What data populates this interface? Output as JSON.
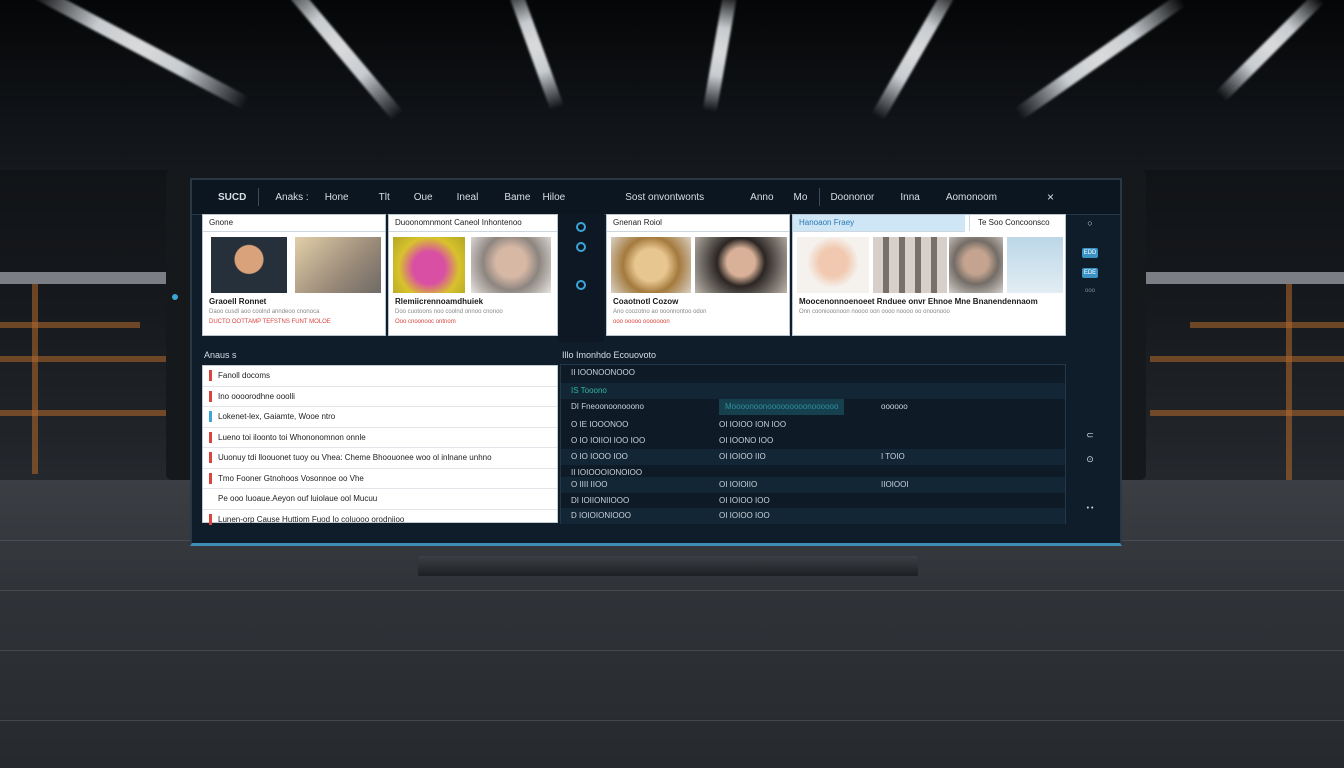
{
  "topbar": {
    "items": [
      "SUCD",
      "Anaks :",
      "Hone",
      "Tlt",
      "Oue",
      "Ineal",
      "Bame",
      "Hiloe",
      "Sost onvontwonts",
      "Anno",
      "Mo",
      "Doononor",
      "Inna",
      "Aomonoom"
    ],
    "close": "×"
  },
  "cards": [
    {
      "title": "Gnone",
      "caption": "Graoell Ronnet",
      "line1": "Daoo cusdl aoo coolnd anndeoo cnonoca",
      "line2": "DUCTO OOTTAMP TEFSTNS FUNT MOLOE"
    },
    {
      "title": "Duoonomnmont  Caneol Inhontenoo",
      "caption": "Rlemiicrennoamdhuiek",
      "line1": "Doo cuotoons noo coolnd onnoo cnonoo",
      "line2": "Ooo cnoonooc ontnom"
    },
    {
      "title": "Gnenan Roiol",
      "caption": "Coaotnotl Cozow",
      "line1": "Ano coozotno ao ooonnontoo odon",
      "line2": "ooo   ooooo  ooooooon"
    },
    {
      "title": "Hanoaon Fraey",
      "caption": "Moocenonnoenoeet Rnduee onvr Ehnoe Mne Bnanendennaom",
      "line1": "Onn cooniooonoon noooo oon oooo noooo oo onoonooo",
      "line2": ""
    },
    {
      "title": "Te  Soo  Concoonsco",
      "caption": "",
      "line1": "",
      "line2": ""
    }
  ],
  "sections": {
    "left": "Anaus  s",
    "right": "Illo Imonhdo Ecouovoto"
  },
  "list_items": [
    {
      "text": "Fanoll docoms",
      "mark": "red"
    },
    {
      "text": "Ino oooorodhne ooolli",
      "mark": "red"
    },
    {
      "text": "Lokenet-lex, Gaiamte, Wooe ntro",
      "mark": "blue"
    },
    {
      "text": "Lueno toi iloonto toi Whononomnon onnle",
      "mark": "red"
    },
    {
      "text": "Uuonuy tdi lloouonet tuoy ou Vhea: Cheme Bhoouonee woo ol inlnane unhno",
      "mark": "red"
    },
    {
      "text": "Tmo Fooner Gtnohoos Vosonnoe oo Vhe",
      "mark": "red"
    },
    {
      "text": "Pe ooo Iuoaue.Aeyon ouf luiolaue ool Mucuu",
      "mark": "none"
    },
    {
      "text": "Lunen-orp Cause Huttiom Fuod Io coluooo orodniioo",
      "mark": "red"
    }
  ],
  "table_rows": [
    {
      "c1": "II IOONOONOOO",
      "c2": "",
      "c3": ""
    },
    {
      "c1": "IS Tooono",
      "c2": "",
      "c3": ""
    },
    {
      "c1": "DI Fneoonoonooono",
      "c2": "Moooonoonooooooooonoooooo",
      "c3": "oooooo"
    },
    {
      "c1": "O  IE  IOOONOO",
      "c2": "OI IOIOO ION IOO",
      "c3": ""
    },
    {
      "c1": "O  IO IOIIOI IOO IOO",
      "c2": "OI IOONO IOO",
      "c3": ""
    },
    {
      "c1": "O  IO IOOO IOO",
      "c2": "OI IOIOO IIO",
      "c3": "I TOIO"
    },
    {
      "c1": "II IOIOOOIONOIOO",
      "c2": "",
      "c3": ""
    },
    {
      "c1": "O  IIII IIOO",
      "c2": "OI IOIOIIO",
      "c3": "IIOIOOI"
    },
    {
      "c1": "DI  IOIIONIIOOO",
      "c2": "OI IOIOO IOO",
      "c3": ""
    },
    {
      "c1": "D  IOIOIONIOOO",
      "c2": "OI IOIOO IOO",
      "c3": ""
    }
  ],
  "right_rail": {
    "pill1": "EDD",
    "pill2": "EDE",
    "small": "ooo"
  }
}
